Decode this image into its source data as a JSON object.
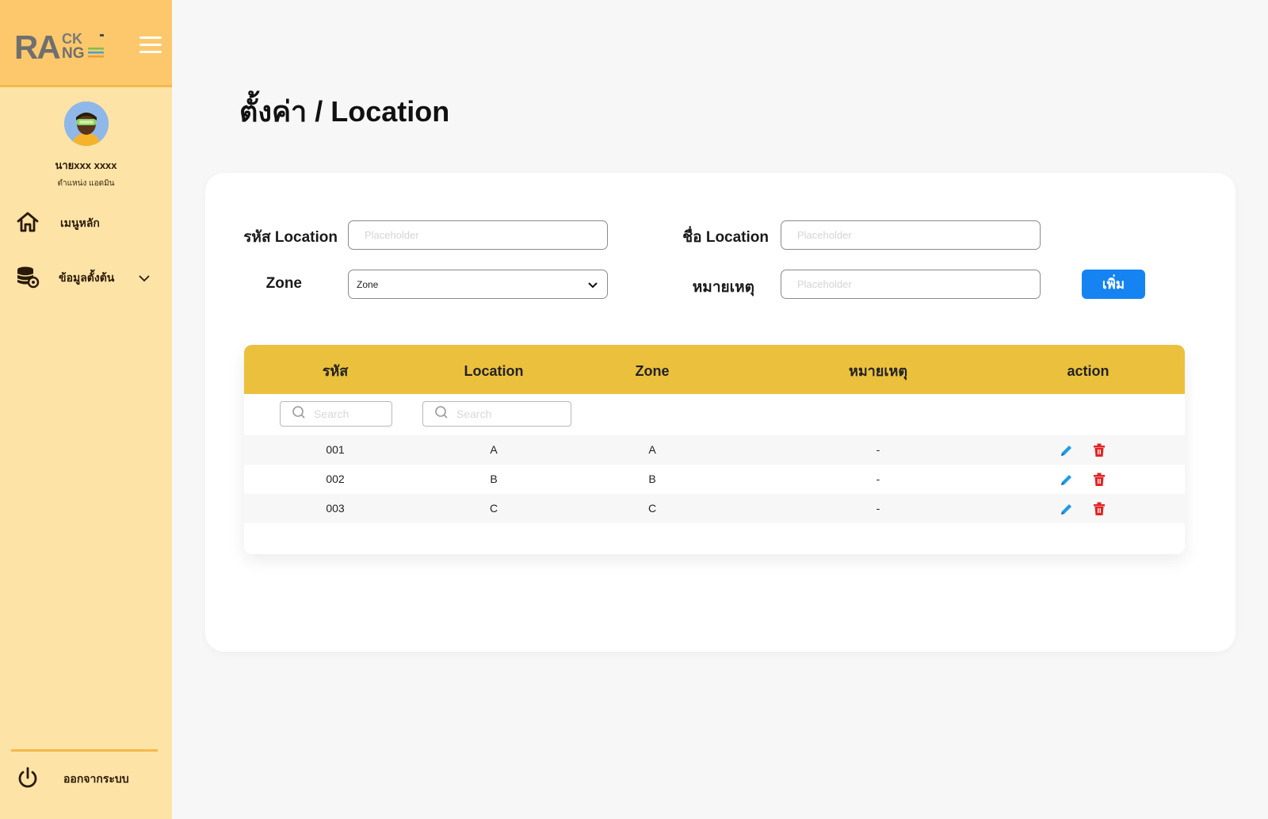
{
  "brand": {
    "logo_main": "RA",
    "logo_top": "CK",
    "logo_bottom": "NG"
  },
  "user": {
    "name": "นายxxx xxxx",
    "role": "ตำแหน่ง แอดมิน"
  },
  "nav": {
    "home_label": "เมนูหลัก",
    "master_data_label": "ข้อมูลตั้งต้น",
    "logout_label": "ออกจากระบบ"
  },
  "page": {
    "title": "ตั้งค่า / Location"
  },
  "form": {
    "code_label": "รหัส Location",
    "code_placeholder": "Placeholder",
    "name_label": "ชื่อ Location",
    "name_placeholder": "Placeholder",
    "zone_label": "Zone",
    "zone_selected": "Zone",
    "note_label": "หมายเหตุ",
    "note_placeholder": "Placeholder",
    "add_button": "เพิ่ม"
  },
  "table": {
    "headers": [
      "รหัส",
      "Location",
      "Zone",
      "หมายเหตุ",
      "action"
    ],
    "search_placeholder": "Search",
    "rows": [
      {
        "code": "001",
        "location": "A",
        "zone": "A",
        "note": "-"
      },
      {
        "code": "002",
        "location": "B",
        "zone": "B",
        "note": "-"
      },
      {
        "code": "003",
        "location": "C",
        "zone": "C",
        "note": "-"
      }
    ]
  },
  "colors": {
    "sidebar_bg": "#fde3a6",
    "sidebar_header_bg": "#fcc86b",
    "table_header_bg": "#ebc03d",
    "primary_button": "#1583f2",
    "edit_icon": "#1e9be8",
    "delete_icon": "#e52222"
  },
  "icons": {
    "menu": "hamburger-icon",
    "home": "home-icon",
    "master_data": "database-settings-icon",
    "expand": "chevron-down-icon",
    "logout": "power-icon",
    "search": "search-icon",
    "edit": "pencil-icon",
    "delete": "trash-icon"
  }
}
